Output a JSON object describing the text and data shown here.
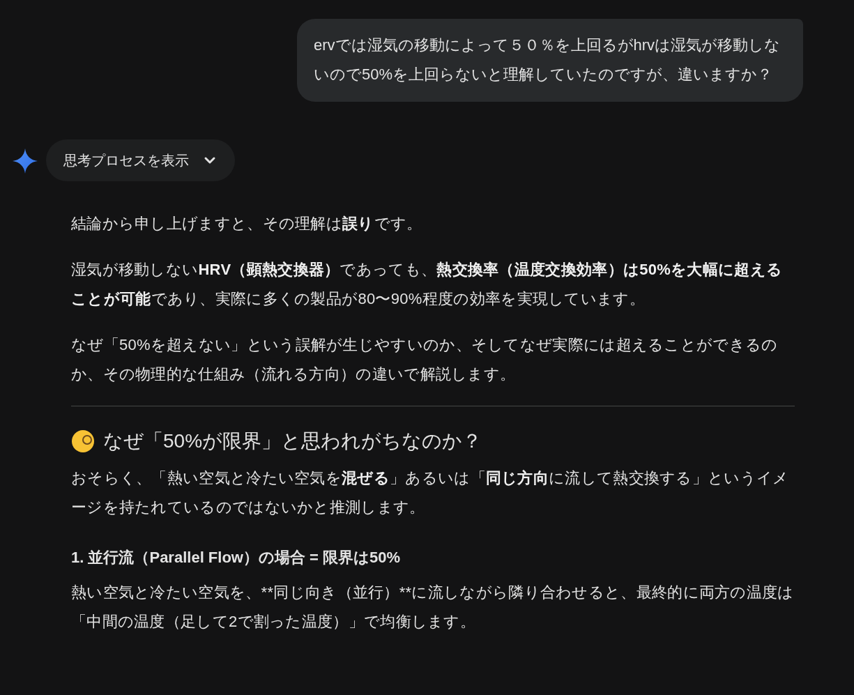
{
  "user_message": {
    "text": "ervでは湿気の移動によって５０％を上回るがhrvは湿気が移動しないので50%を上回らないと理解していたのですが、違いますか？"
  },
  "thinking_toggle": {
    "label": "思考プロセスを表示",
    "expanded": false
  },
  "response": [
    {
      "kind": "paragraph",
      "text": "結論から申し上げますと、その理解は**誤り**です。"
    },
    {
      "kind": "paragraph",
      "text": "湿気が移動しない**HRV（顕熱交換器）**であっても、**熱交換率（温度交換効率）は50%を大幅に超えることが可能**であり、実際に多くの製品が80〜90%程度の効率を実現しています。"
    },
    {
      "kind": "paragraph",
      "text": "なぜ「50%を超えない」という誤解が生じやすいのか、そしてなぜ実際には超えることができるのか、その物理的な仕組み（流れる方向）の違いで解説します。"
    },
    {
      "kind": "divider"
    },
    {
      "kind": "heading",
      "text": "なぜ「50%が限界」と思われがちなのか？"
    },
    {
      "kind": "paragraph",
      "text": "おそらく、「熱い空気と冷たい空気を**混ぜる**」あるいは「**同じ方向**に流して熱交換する」というイメージを持たれているのではないかと推測します。"
    },
    {
      "kind": "subheading",
      "text": "1. 並行流（Parallel Flow）の場合 = 限界は50%"
    },
    {
      "kind": "literal",
      "text": "熱い空気と冷たい空気を、**同じ向き（並行）**に流しながら隣り合わせると、最終的に両方の温度は「中間の温度（足して2で割った温度）」で均衡します。"
    }
  ]
}
